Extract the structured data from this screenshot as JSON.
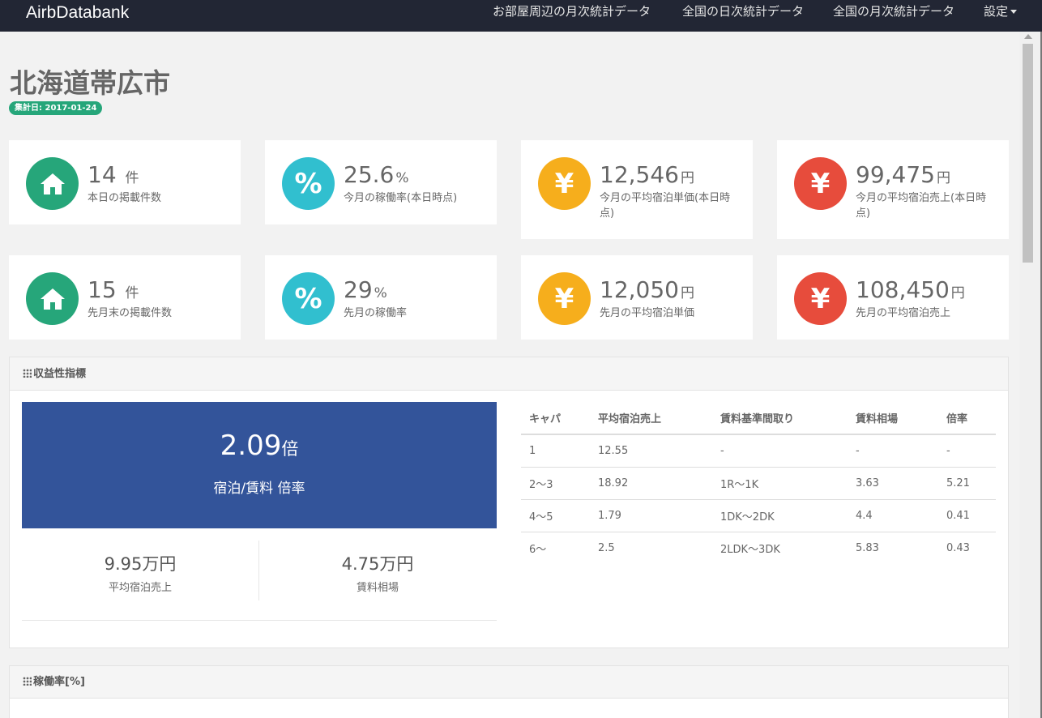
{
  "nav": {
    "brand": "AirbDatabank",
    "links": [
      "お部屋周辺の月次統計データ",
      "全国の日次統計データ",
      "全国の月次統計データ",
      "設定"
    ]
  },
  "page": {
    "title": "北海道帯広市",
    "date_badge": "集計日: 2017-01-24"
  },
  "cards": [
    {
      "value": "14",
      "unit": "件",
      "label": "本日の掲載件数",
      "icon": "home-icon",
      "color": "#26a67a"
    },
    {
      "value": "25.6",
      "unit": "%",
      "label": "今月の稼働率(本日時点)",
      "icon": "percent-icon",
      "color": "#31bfcf"
    },
    {
      "value": "12,546",
      "unit": "円",
      "label": "今月の平均宿泊単価(本日時点)",
      "icon": "yen-icon",
      "color": "#f6ae1c"
    },
    {
      "value": "99,475",
      "unit": "円",
      "label": "今月の平均宿泊売上(本日時点)",
      "icon": "yen-icon",
      "color": "#e74c3c"
    },
    {
      "value": "15",
      "unit": "件",
      "label": "先月末の掲載件数",
      "icon": "home-icon",
      "color": "#26a67a"
    },
    {
      "value": "29",
      "unit": "%",
      "label": "先月の稼働率",
      "icon": "percent-icon",
      "color": "#31bfcf"
    },
    {
      "value": "12,050",
      "unit": "円",
      "label": "先月の平均宿泊単価",
      "icon": "yen-icon",
      "color": "#f6ae1c"
    },
    {
      "value": "108,450",
      "unit": "円",
      "label": "先月の平均宿泊売上",
      "icon": "yen-icon",
      "color": "#e74c3c"
    }
  ],
  "profitability": {
    "heading": "収益性指標",
    "big_value": "2.09",
    "big_unit": "倍",
    "big_label": "宿泊/賃料 倍率",
    "avg_sales_value": "9.95万円",
    "avg_sales_label": "平均宿泊売上",
    "rent_value": "4.75万円",
    "rent_label": "賃料相場",
    "table": {
      "headers": [
        "キャパ",
        "平均宿泊売上",
        "賃料基準間取り",
        "賃料相場",
        "倍率"
      ],
      "rows": [
        [
          "1",
          "12.55",
          "-",
          "-",
          "-"
        ],
        [
          "2〜3",
          "18.92",
          "1R〜1K",
          "3.63",
          "5.21"
        ],
        [
          "4〜5",
          "1.79",
          "1DK〜2DK",
          "4.4",
          "0.41"
        ],
        [
          "6〜",
          "2.5",
          "2LDK〜3DK",
          "5.83",
          "0.43"
        ]
      ]
    }
  },
  "occupancy": {
    "heading": "稼働率[%]"
  }
}
